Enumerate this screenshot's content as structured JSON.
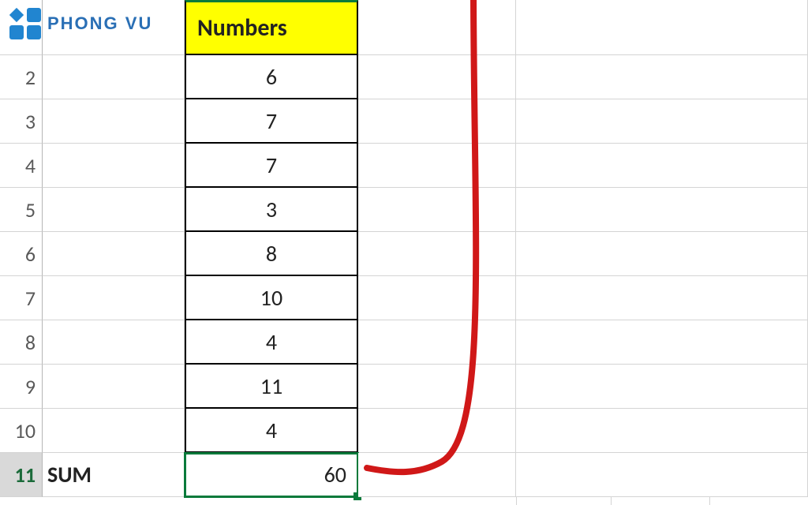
{
  "logo": {
    "text": "PHONG VU"
  },
  "row_numbers": [
    "",
    "2",
    "3",
    "4",
    "5",
    "6",
    "7",
    "8",
    "9",
    "10",
    "11"
  ],
  "columnA": {
    "sum_label": "SUM"
  },
  "columnB": {
    "header": "Numbers",
    "values": [
      "6",
      "7",
      "7",
      "3",
      "8",
      "10",
      "4",
      "11",
      "4"
    ],
    "sum_result": "60"
  },
  "active_cell": "B11",
  "chart_data": {
    "type": "table",
    "title": "Numbers",
    "categories": [
      "Row2",
      "Row3",
      "Row4",
      "Row5",
      "Row6",
      "Row7",
      "Row8",
      "Row9",
      "Row10"
    ],
    "values": [
      6,
      7,
      7,
      3,
      8,
      10,
      4,
      11,
      4
    ],
    "sum": 60
  }
}
